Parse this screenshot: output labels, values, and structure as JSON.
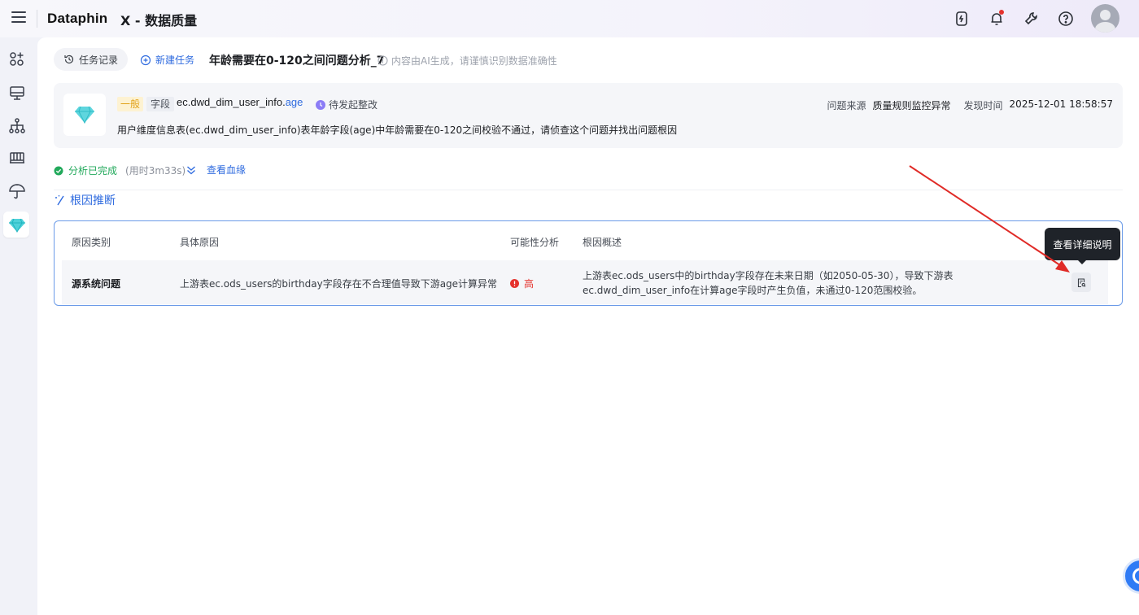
{
  "header": {
    "logo": "Dataphin",
    "title": "X - 数据质量",
    "icons": [
      "upload-task-icon",
      "bell-icon",
      "wrench-icon",
      "help-icon",
      "avatar"
    ]
  },
  "sidebar": {
    "items": [
      "apps-icon",
      "monitor-icon",
      "lineage-icon",
      "database-icon",
      "umbrella-icon",
      "diamond-icon"
    ],
    "active": "diamond-icon"
  },
  "toolbar": {
    "history_label": "任务记录",
    "new_task_label": "新建任务",
    "task_title": "年龄需要在0-120之间问题分析_7",
    "ai_note": "内容由AI生成，请谨慎识别数据准确性"
  },
  "issue": {
    "level": "一般",
    "type": "字段",
    "field_prefix": "ec.dwd_dim_user_info.",
    "field_highlight": "age",
    "status": "待发起整改",
    "source_label": "问题来源",
    "source_value": "质量规则监控异常",
    "found_label": "发现时间",
    "found_value": "2025-12-01 18:58:57",
    "description": "用户维度信息表(ec.dwd_dim_user_info)表年龄字段(age)中年龄需要在0-120之间校验不通过，请侦查这个问题并找出问题根因"
  },
  "analysis": {
    "status": "分析已完成",
    "duration": "(用时3m33s)",
    "lineage_label": "查看血缘"
  },
  "root_cause": {
    "section_title": "根因推断",
    "columns": [
      "原因类别",
      "具体原因",
      "可能性分析",
      "根因概述"
    ],
    "rows": [
      {
        "category": "源系统问题",
        "reason": "上游表ec.ods_users的birthday字段存在不合理值导致下游age计算异常",
        "possibility": "高",
        "summary": "上游表ec.ods_users中的birthday字段存在未来日期（如2050-05-30），导致下游表ec.dwd_dim_user_info在计算age字段时产生负值，未通过0-120范围校验。"
      }
    ],
    "tooltip": "查看详细说明"
  },
  "colors": {
    "accent": "#2f6bdf",
    "success": "#22a95b",
    "danger": "#e5322d",
    "warning_tag": "#e1a21a"
  }
}
